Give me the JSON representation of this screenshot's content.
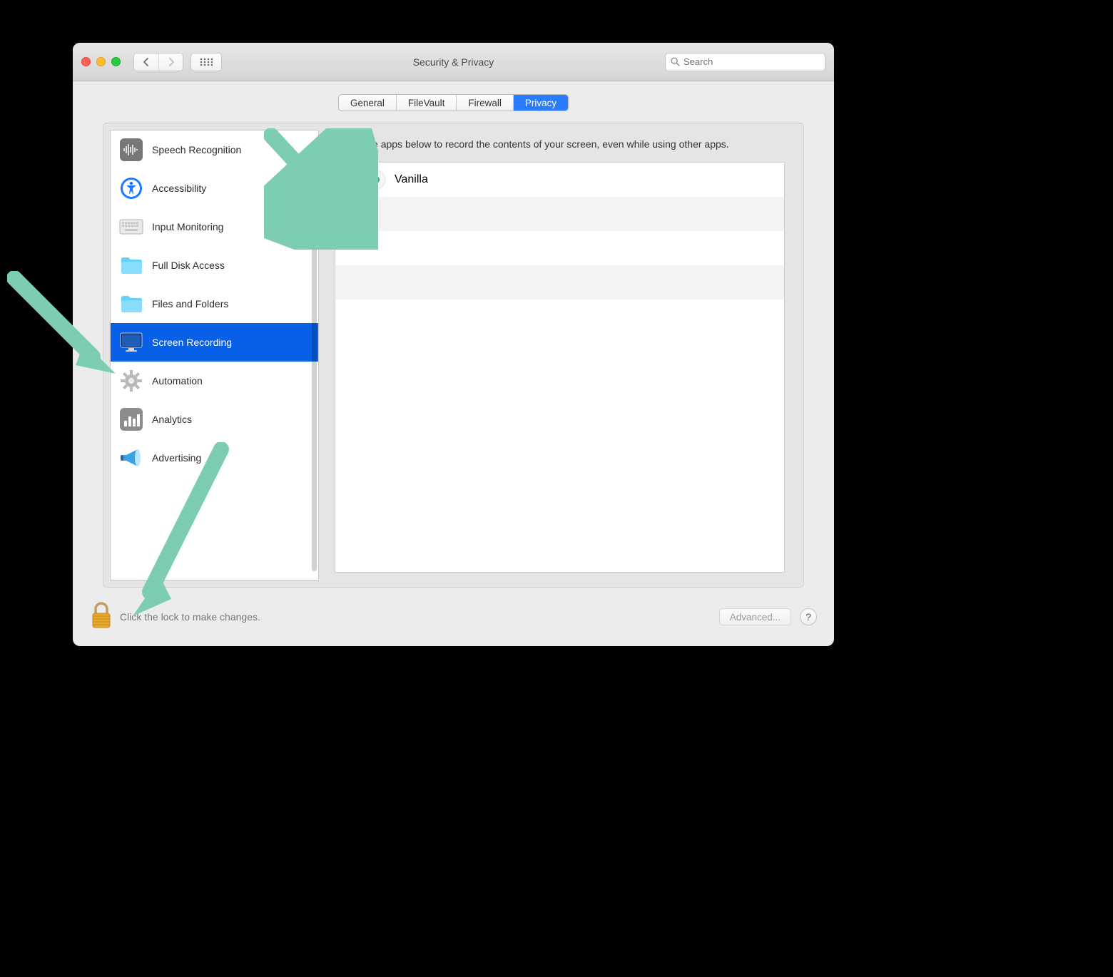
{
  "window": {
    "title": "Security & Privacy",
    "search_placeholder": "Search"
  },
  "tabs": [
    {
      "label": "General",
      "active": false
    },
    {
      "label": "FileVault",
      "active": false
    },
    {
      "label": "Firewall",
      "active": false
    },
    {
      "label": "Privacy",
      "active": true
    }
  ],
  "sidebar": {
    "items": [
      {
        "label": "Speech Recognition",
        "icon": "waveform-icon",
        "selected": false
      },
      {
        "label": "Accessibility",
        "icon": "accessibility-icon",
        "selected": false
      },
      {
        "label": "Input Monitoring",
        "icon": "keyboard-icon",
        "selected": false
      },
      {
        "label": "Full Disk Access",
        "icon": "folder-icon",
        "selected": false
      },
      {
        "label": "Files and Folders",
        "icon": "folder-icon",
        "selected": false
      },
      {
        "label": "Screen Recording",
        "icon": "display-icon",
        "selected": true
      },
      {
        "label": "Automation",
        "icon": "gear-icon",
        "selected": false
      },
      {
        "label": "Analytics",
        "icon": "chart-icon",
        "selected": false
      },
      {
        "label": "Advertising",
        "icon": "megaphone-icon",
        "selected": false
      }
    ]
  },
  "pane": {
    "description": "Allow the apps below to record the contents of your screen, even while using other apps.",
    "apps": [
      {
        "name": "Vanilla",
        "checked": false,
        "icon": "vanilla-dot-icon"
      }
    ]
  },
  "footer": {
    "lock_text": "Click the lock to make changes.",
    "advanced_label": "Advanced...",
    "help_label": "?"
  },
  "arrow_color": "#7dceb1"
}
